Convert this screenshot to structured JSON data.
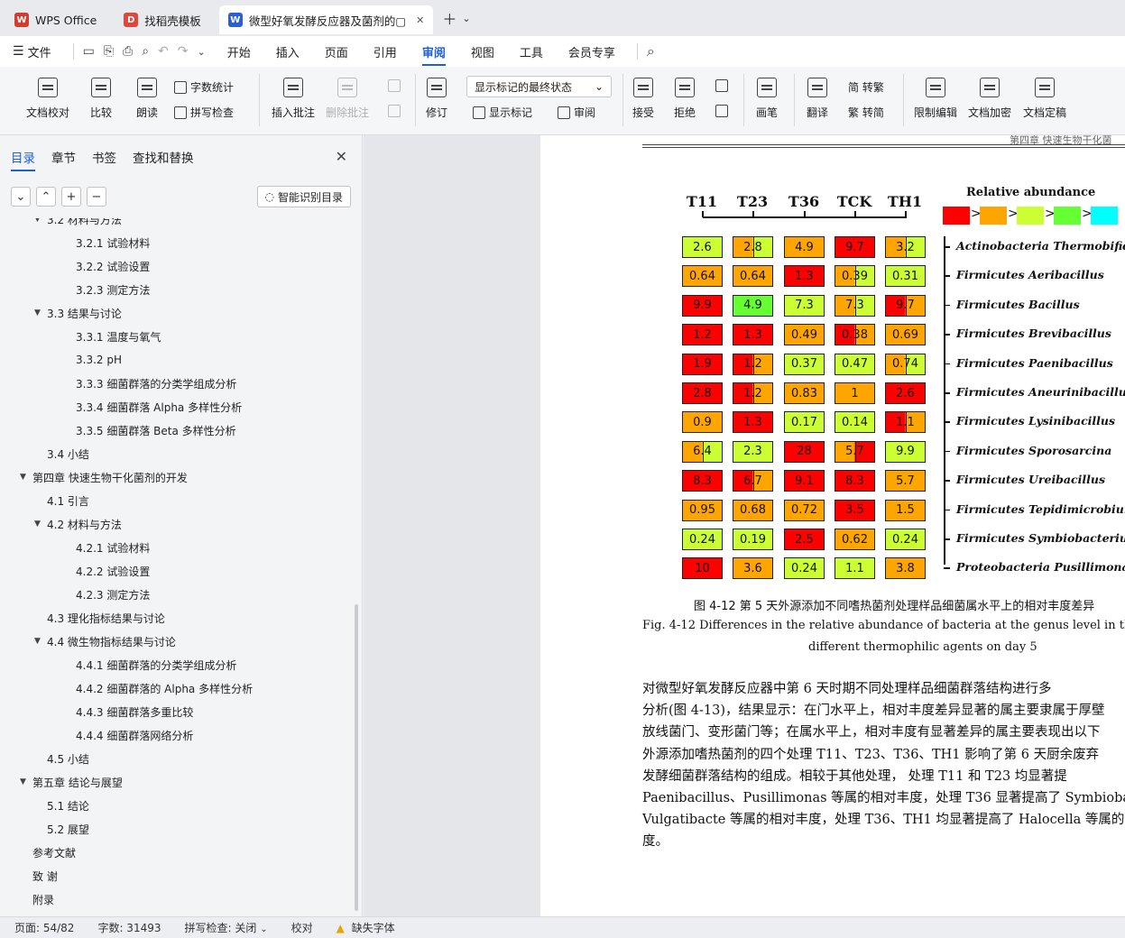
{
  "tabs": [
    {
      "label": "WPS Office",
      "logo": "W",
      "color": "#d83a2d"
    },
    {
      "label": "找稻壳模板",
      "logo": "D",
      "color": "#e0463a"
    },
    {
      "label": "微型好氧发酵反应器及菌剂的▢",
      "logo": "W",
      "color": "#2a5fd8",
      "active": true
    }
  ],
  "menu": {
    "file": "文件",
    "tabs": [
      "开始",
      "插入",
      "页面",
      "引用",
      "审阅",
      "视图",
      "工具",
      "会员专享"
    ],
    "active_tab": "审阅"
  },
  "ribbon": {
    "doc_check": "文档校对",
    "compare": "比较",
    "read_aloud": "朗读",
    "word_count": "字数统计",
    "spell_check": "拼写检查",
    "insert_comment": "插入批注",
    "delete_comment": "删除批注",
    "revise": "修订",
    "markup_select": "显示标记的最终状态",
    "show_markup": "显示标记",
    "review": "审阅",
    "accept": "接受",
    "reject": "拒绝",
    "pen": "画笔",
    "translate": "翻译",
    "to_traditional": "简 转繁",
    "to_simplified": "繁 转简",
    "restrict_edit": "限制编辑",
    "encrypt": "文档加密",
    "finalize": "文档定稿"
  },
  "nav": {
    "tabs": [
      "目录",
      "章节",
      "书签",
      "查找和替换"
    ],
    "active_tab": "目录",
    "smart_toc": "智能识别目录",
    "items": [
      {
        "label": "3.2 材料与方法",
        "level": 2,
        "arrow": true
      },
      {
        "label": "3.2.1 试验材料",
        "level": 3
      },
      {
        "label": "3.2.2 试验设置",
        "level": 3
      },
      {
        "label": "3.2.3 测定方法",
        "level": 3
      },
      {
        "label": "3.3 结果与讨论",
        "level": 2,
        "arrow": true
      },
      {
        "label": "3.3.1 温度与氧气",
        "level": 3
      },
      {
        "label": "3.3.2 pH",
        "level": 3
      },
      {
        "label": "3.3.3 细菌群落的分类学组成分析",
        "level": 3
      },
      {
        "label": "3.3.4 细菌群落 Alpha 多样性分析",
        "level": 3
      },
      {
        "label": "3.3.5 细菌群落 Beta 多样性分析",
        "level": 3
      },
      {
        "label": "3.4 小结",
        "level": 2
      },
      {
        "label": "第四章  快速生物干化菌剂的开发",
        "level": 1,
        "arrow": true
      },
      {
        "label": "4.1 引言",
        "level": 2
      },
      {
        "label": "4.2 材料与方法",
        "level": 2,
        "arrow": true
      },
      {
        "label": "4.2.1 试验材料",
        "level": 3
      },
      {
        "label": "4.2.2 试验设置",
        "level": 3
      },
      {
        "label": "4.2.3 测定方法",
        "level": 3
      },
      {
        "label": "4.3 理化指标结果与讨论",
        "level": 2
      },
      {
        "label": "4.4 微生物指标结果与讨论",
        "level": 2,
        "arrow": true
      },
      {
        "label": "4.4.1 细菌群落的分类学组成分析",
        "level": 3
      },
      {
        "label": "4.4.2 细菌群落的 Alpha 多样性分析",
        "level": 3
      },
      {
        "label": "4.4.3 细菌群落多重比较",
        "level": 3
      },
      {
        "label": "4.4.4 细菌群落网络分析",
        "level": 3
      },
      {
        "label": "4.5 小结",
        "level": 2
      },
      {
        "label": "第五章  结论与展望",
        "level": 1,
        "arrow": true
      },
      {
        "label": "5.1 结论",
        "level": 2
      },
      {
        "label": "5.2 展望",
        "level": 2
      },
      {
        "label": "参考文献",
        "level": 1
      },
      {
        "label": "致  谢",
        "level": 1
      },
      {
        "label": "附录",
        "level": 1
      }
    ]
  },
  "document": {
    "header_text": "第四章  快速生物干化菌",
    "chart": {
      "columns": [
        "T11",
        "T23",
        "T36",
        "TCK",
        "TH1"
      ],
      "legend_title": "Relative abundance",
      "legend_colors": [
        "#ff0000",
        "#ffa500",
        "#ccff33",
        "#66ff33",
        "#00ffff"
      ],
      "palette": {
        "R": "#ff0000",
        "O": "#ffa500",
        "Y": "#ccff33",
        "G": "#66ff33"
      },
      "rows": [
        {
          "label": "Actinobacteria Thermobifida",
          "cells": [
            [
              "2.6",
              "Y"
            ],
            [
              "2.8",
              "O|Y"
            ],
            [
              "4.9",
              "O"
            ],
            [
              "9.7",
              "R"
            ],
            [
              "3.2",
              "O|Y"
            ]
          ]
        },
        {
          "label": "Firmicutes Aeribacillus",
          "cells": [
            [
              "0.64",
              "O"
            ],
            [
              "0.64",
              "O"
            ],
            [
              "1.3",
              "R"
            ],
            [
              "0.39",
              "O|Y"
            ],
            [
              "0.31",
              "Y"
            ]
          ]
        },
        {
          "label": "Firmicutes Bacillus",
          "cells": [
            [
              "9.9",
              "R"
            ],
            [
              "4.9",
              "G"
            ],
            [
              "7.3",
              "Y"
            ],
            [
              "7.3",
              "O|Y"
            ],
            [
              "9.7",
              "R|O"
            ]
          ]
        },
        {
          "label": "Firmicutes Brevibacillus",
          "cells": [
            [
              "1.2",
              "R"
            ],
            [
              "1.3",
              "R"
            ],
            [
              "0.49",
              "O"
            ],
            [
              "0.38",
              "R|O"
            ],
            [
              "0.69",
              "O"
            ]
          ]
        },
        {
          "label": "Firmicutes Paenibacillus",
          "cells": [
            [
              "1.9",
              "R"
            ],
            [
              "1.2",
              "R|O"
            ],
            [
              "0.37",
              "Y"
            ],
            [
              "0.47",
              "Y"
            ],
            [
              "0.74",
              "O|Y"
            ]
          ]
        },
        {
          "label": "Firmicutes Aneurinibacillus",
          "cells": [
            [
              "2.8",
              "R"
            ],
            [
              "1.2",
              "R|O"
            ],
            [
              "0.83",
              "O"
            ],
            [
              "1",
              "O"
            ],
            [
              "2.6",
              "R"
            ]
          ]
        },
        {
          "label": "Firmicutes Lysinibacillus",
          "cells": [
            [
              "0.9",
              "O"
            ],
            [
              "1.3",
              "R"
            ],
            [
              "0.17",
              "Y"
            ],
            [
              "0.14",
              "Y"
            ],
            [
              "1.1",
              "R|O"
            ]
          ]
        },
        {
          "label": "Firmicutes Sporosarcina",
          "cells": [
            [
              "6.4",
              "O|Y"
            ],
            [
              "2.3",
              "Y"
            ],
            [
              "28",
              "R"
            ],
            [
              "5.7",
              "O|R"
            ],
            [
              "9.9",
              "Y"
            ]
          ]
        },
        {
          "label": "Firmicutes Ureibacillus",
          "cells": [
            [
              "8.3",
              "R"
            ],
            [
              "6.7",
              "R|O"
            ],
            [
              "9.1",
              "R"
            ],
            [
              "8.3",
              "R"
            ],
            [
              "5.7",
              "O"
            ]
          ]
        },
        {
          "label": "Firmicutes Tepidimicrobium",
          "cells": [
            [
              "0.95",
              "O"
            ],
            [
              "0.68",
              "O"
            ],
            [
              "0.72",
              "O"
            ],
            [
              "3.5",
              "R"
            ],
            [
              "1.5",
              "O"
            ]
          ]
        },
        {
          "label": "Firmicutes Symbiobacterium",
          "cells": [
            [
              "0.24",
              "Y"
            ],
            [
              "0.19",
              "Y"
            ],
            [
              "2.5",
              "R"
            ],
            [
              "0.62",
              "O"
            ],
            [
              "0.24",
              "Y"
            ]
          ]
        },
        {
          "label": "Proteobacteria Pusillimonas",
          "cells": [
            [
              "10",
              "R"
            ],
            [
              "3.6",
              "O"
            ],
            [
              "0.24",
              "Y"
            ],
            [
              "1.1",
              "Y"
            ],
            [
              "3.8",
              "O"
            ]
          ]
        }
      ]
    },
    "caption_cn": "图 4-12  第 5 天外源添加不同嗜热菌剂处理样品细菌属水平上的相对丰度差异",
    "caption_en_1": "Fig. 4-12 Differences in the relative abundance of bacteria at the genus level in the samples trea",
    "caption_en_2": "different thermophilic agents on day 5",
    "paragraph": [
      "    对微型好氧发酵反应器中第 6 天时期不同处理样品细菌群落结构进行多",
      "分析(图 4-13)，结果显示：在门水平上，相对丰度差异显著的属主要隶属于厚壁",
      "放线菌门、变形菌门等；在属水平上，相对丰度有显著差异的属主要表现出以下",
      "外源添加嗜热菌剂的四个处理 T11、T23、T36、TH1 影响了第 6 天厨余废弃",
      "发酵细菌群落结构的组成。相较于其他处理， 处理 T11 和 T23 均显著提",
      "Paenibacillus、Pusillimonas 等属的相对丰度，处理 T36 显著提高了 Symbiobac",
      "Vulgatibacte 等属的相对丰度，处理 T36、TH1 均显著提高了 Halocella 等属的",
      "度。"
    ]
  },
  "status": {
    "page": "页面: 54/82",
    "words": "字数: 31493",
    "spell": "拼写检查: 关闭",
    "proof": "校对",
    "missing_font": "缺失字体"
  }
}
